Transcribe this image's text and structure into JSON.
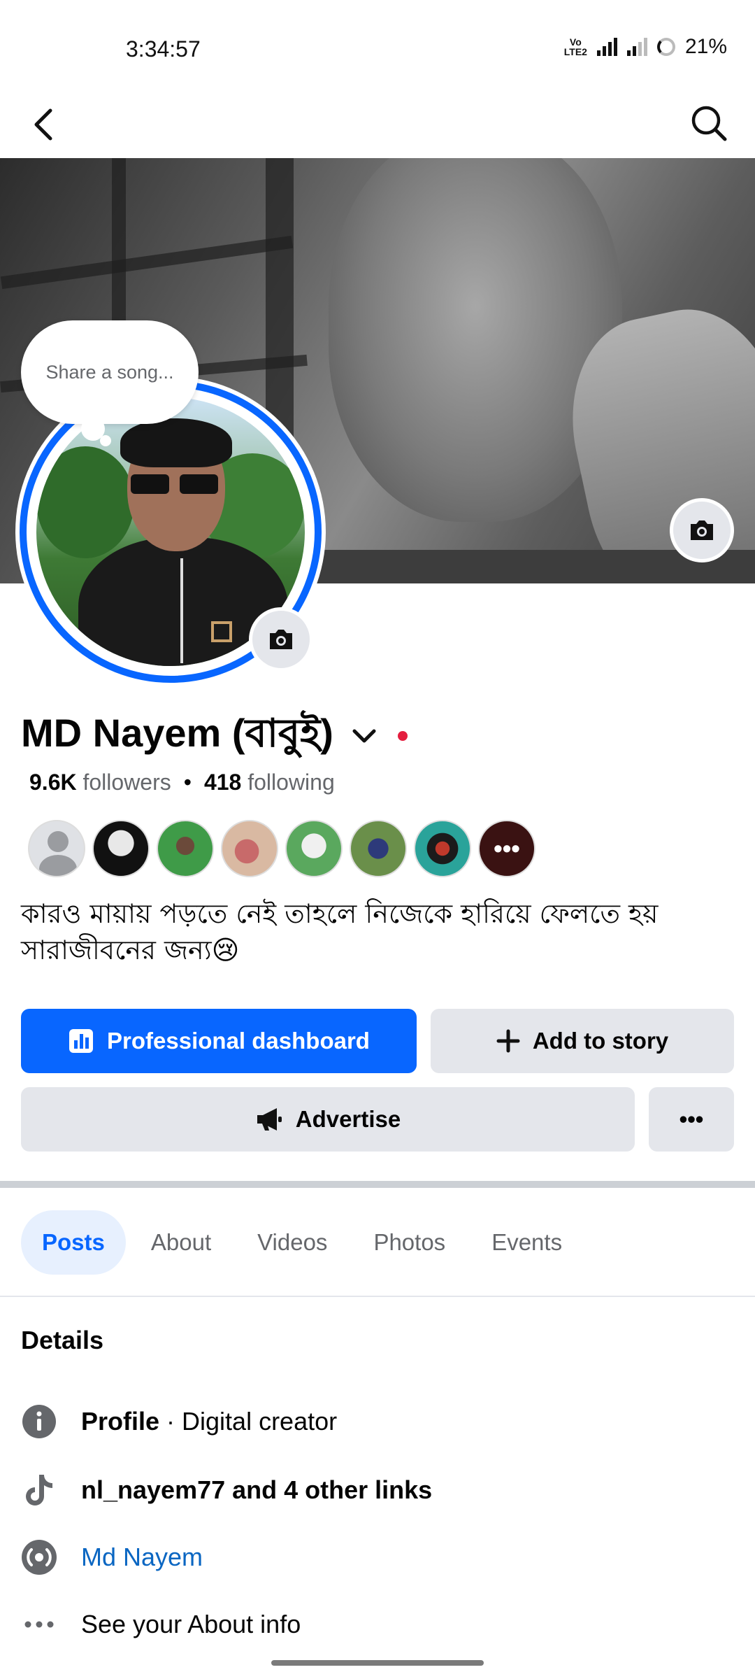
{
  "status_bar": {
    "time": "3:34:57",
    "volte": "Vo LTE2",
    "network": "4G",
    "battery": "21%"
  },
  "profile": {
    "name": "MD Nayem (বাবুই)",
    "followers_count": "9.6K",
    "followers_label": "followers",
    "following_count": "418",
    "following_label": "following",
    "bio": "কারও মায়ায় পড়তে নেই তাহলে নিজেকে হারিয়ে ফেলতে হয় সারাজীবনের জন্য😢",
    "note_bubble": "Share a song..."
  },
  "mutuals_more": "•••",
  "actions": {
    "professional_dashboard": "Professional dashboard",
    "add_to_story": "Add to story",
    "advertise": "Advertise",
    "more": "•••"
  },
  "tabs": [
    "Posts",
    "About",
    "Videos",
    "Photos",
    "Events"
  ],
  "details": {
    "title": "Details",
    "profile_label": "Profile",
    "profile_type": " · Digital creator",
    "links": "nl_nayem77 and 4 other links",
    "page_link": "Md Nayem",
    "see_about": "See your About info"
  },
  "colors": {
    "accent": "#0866ff",
    "button_gray": "#e4e6eb",
    "secondary_text": "#65676b",
    "online_dot": "#e41e3f"
  }
}
